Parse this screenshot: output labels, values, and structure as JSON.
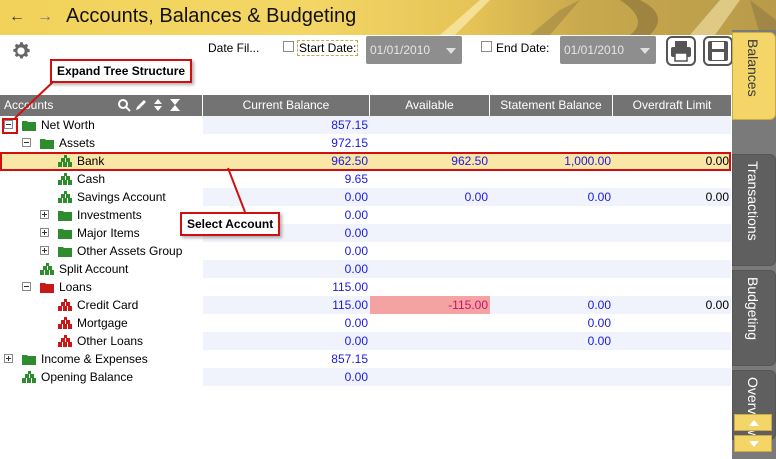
{
  "app": {
    "title": "Accounts, Balances & Budgeting"
  },
  "toolbar": {
    "date_filter_label": "Date Fil...",
    "start_date_label": "Start Date:",
    "start_date_value": "01/01/2010",
    "end_date_label": "End Date:",
    "end_date_value": "01/01/2010",
    "print_icon": "printer-icon",
    "save_icon": "floppy-disk-icon",
    "settings_icon": "gear-icon"
  },
  "side_tabs": [
    {
      "label": "Balances",
      "active": true
    },
    {
      "label": "Transactions",
      "active": false
    },
    {
      "label": "Budgeting",
      "active": false
    },
    {
      "label": "Overview",
      "active": false
    }
  ],
  "grid": {
    "columns": [
      "Accounts",
      "Current Balance",
      "Available",
      "Statement Balance",
      "Overdraft Limit"
    ],
    "header_icons": [
      "search-icon",
      "pencil-icon",
      "sort-icon",
      "hourglass-icon"
    ],
    "rows": [
      {
        "name": "Net Worth",
        "current": "857.15",
        "available": "",
        "statement": "",
        "overdraft": "",
        "level": 0,
        "expander": "minus",
        "icon": "folder-green"
      },
      {
        "name": "Assets",
        "current": "972.15",
        "available": "",
        "statement": "",
        "overdraft": "",
        "level": 1,
        "expander": "minus",
        "icon": "folder-green"
      },
      {
        "name": "Bank",
        "current": "962.50",
        "available": "962.50",
        "statement": "1,000.00",
        "overdraft": "0.00",
        "level": 2,
        "expander": "",
        "icon": "account-green",
        "selected": true
      },
      {
        "name": "Cash",
        "current": "9.65",
        "available": "",
        "statement": "",
        "overdraft": "",
        "level": 2,
        "expander": "",
        "icon": "account-green"
      },
      {
        "name": "Savings Account",
        "current": "0.00",
        "available": "0.00",
        "statement": "0.00",
        "overdraft": "0.00",
        "level": 2,
        "expander": "",
        "icon": "account-green"
      },
      {
        "name": "Investments",
        "current": "0.00",
        "available": "",
        "statement": "",
        "overdraft": "",
        "level": 2,
        "expander": "plus",
        "icon": "folder-green"
      },
      {
        "name": "Major Items",
        "current": "0.00",
        "available": "",
        "statement": "",
        "overdraft": "",
        "level": 2,
        "expander": "plus",
        "icon": "folder-green"
      },
      {
        "name": "Other Assets Group",
        "current": "0.00",
        "available": "",
        "statement": "",
        "overdraft": "",
        "level": 2,
        "expander": "plus",
        "icon": "folder-green"
      },
      {
        "name": "Split Account",
        "current": "0.00",
        "available": "",
        "statement": "",
        "overdraft": "",
        "level": 1,
        "expander": "",
        "icon": "account-green"
      },
      {
        "name": "Loans",
        "current": "115.00",
        "available": "",
        "statement": "",
        "overdraft": "",
        "level": 1,
        "expander": "minus",
        "icon": "folder-red"
      },
      {
        "name": "Credit Card",
        "current": "115.00",
        "available": "-115.00",
        "statement": "0.00",
        "overdraft": "0.00",
        "level": 2,
        "expander": "",
        "icon": "account-red",
        "available_negative": true
      },
      {
        "name": "Mortgage",
        "current": "0.00",
        "available": "",
        "statement": "0.00",
        "overdraft": "",
        "level": 2,
        "expander": "",
        "icon": "account-red"
      },
      {
        "name": "Other Loans",
        "current": "0.00",
        "available": "",
        "statement": "0.00",
        "overdraft": "",
        "level": 2,
        "expander": "",
        "icon": "account-red"
      },
      {
        "name": "Income & Expenses",
        "current": "857.15",
        "available": "",
        "statement": "",
        "overdraft": "",
        "level": 0,
        "expander": "plus",
        "icon": "folder-green"
      },
      {
        "name": "Opening Balance",
        "current": "0.00",
        "available": "",
        "statement": "",
        "overdraft": "",
        "level": 0,
        "expander": "",
        "icon": "account-green"
      }
    ]
  },
  "callouts": {
    "expand": "Expand Tree Structure",
    "select": "Select Account"
  },
  "colors": {
    "accent_yellow": "#f3d568",
    "selected_row": "#f8e7a6",
    "number_blue": "#1a1ae0",
    "negative_bg": "#f4a3a3",
    "header_gray": "#737373",
    "callout_red": "#d01010"
  }
}
